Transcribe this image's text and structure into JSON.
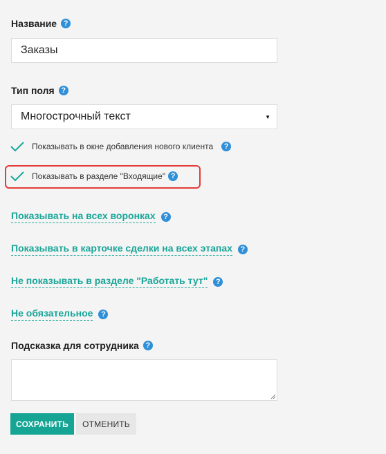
{
  "name_field": {
    "label": "Название",
    "value": "Заказы",
    "help_icon": "help-circle-icon"
  },
  "field_type": {
    "label": "Тип поля",
    "selected": "Многострочный текст",
    "caret": "▼",
    "help_icon": "help-circle-icon"
  },
  "checkboxes": [
    {
      "label": "Показывать в окне добавления нового клиента",
      "checked": true
    },
    {
      "label": "Показывать в разделе \"Входящие\"",
      "checked": true,
      "highlighted": true
    }
  ],
  "links": [
    {
      "label": "Показывать на всех воронках"
    },
    {
      "label": "Показывать в карточке сделки на всех этапах"
    },
    {
      "label": "Не показывать в разделе \"Работать тут\""
    },
    {
      "label": "Не обязательное"
    }
  ],
  "hint_field": {
    "label": "Подсказка для сотрудника",
    "value": "",
    "help_icon": "help-circle-icon"
  },
  "help_glyph": "?",
  "buttons": {
    "save": "СОХРАНИТЬ",
    "cancel": "ОТМЕНИТЬ"
  },
  "colors": {
    "accent": "#16a594",
    "link": "#1aa69a",
    "help": "#2f8fd8",
    "highlight": "#e23b3b",
    "background": "#f3f4f3"
  }
}
